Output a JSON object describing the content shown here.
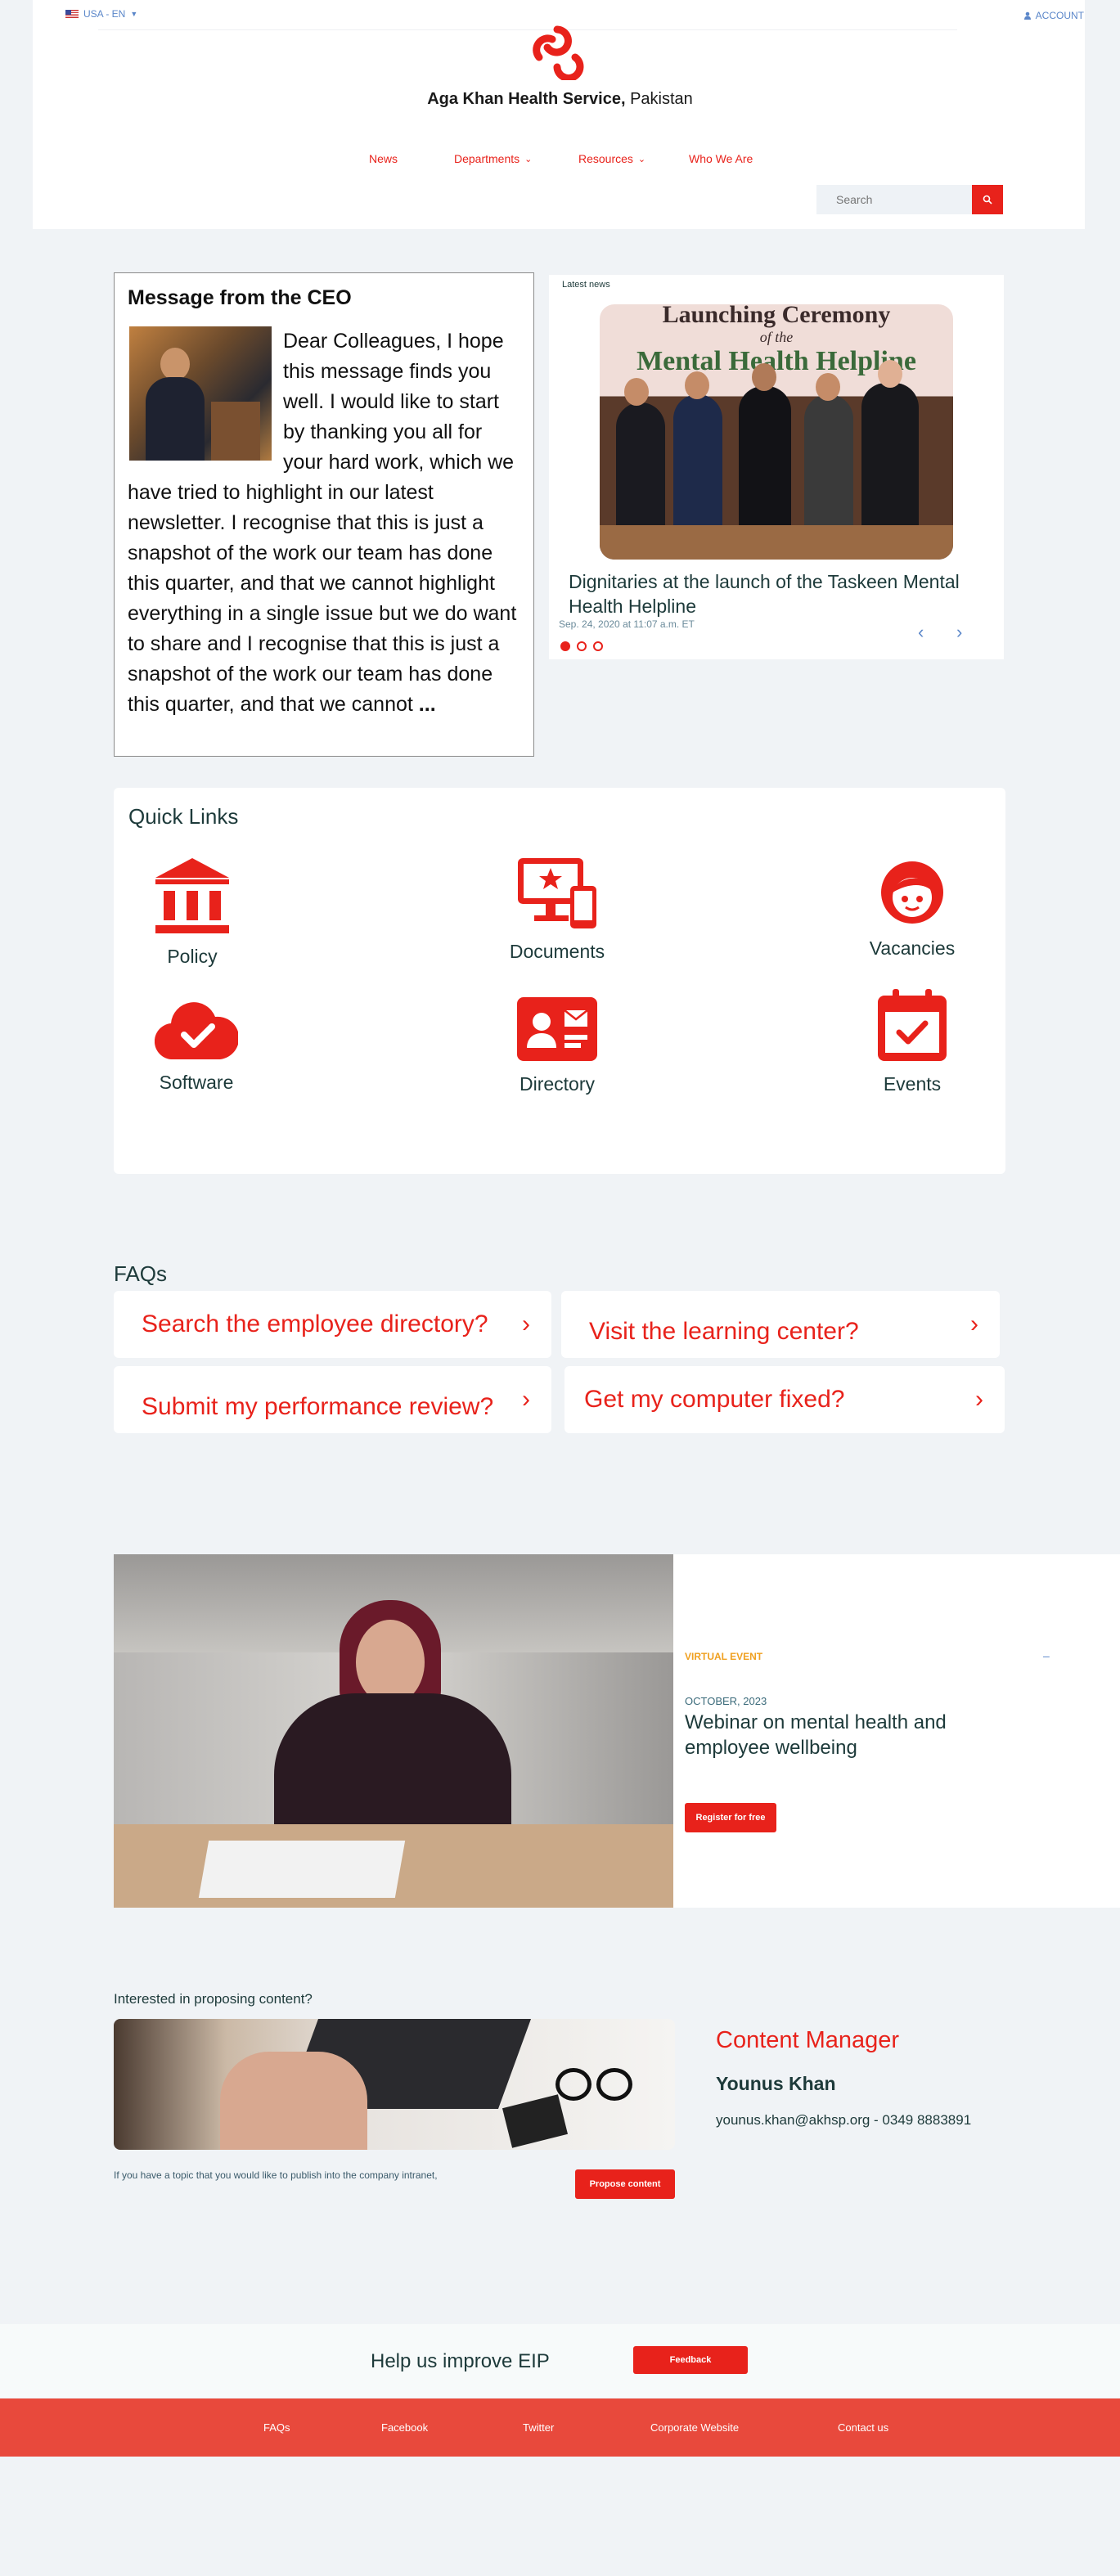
{
  "header": {
    "locale": "USA - EN",
    "account": "ACCOUNT",
    "brand_bold": "Aga Khan Health Service,",
    "brand_rest": " Pakistan",
    "nav": [
      "News",
      "Departments",
      "Resources",
      "Who We Are"
    ],
    "search_placeholder": "Search",
    "accent": "#e8221b"
  },
  "ceo": {
    "title": "Message from the CEO",
    "body": "Dear Colleagues, I hope this message finds you well.  I would like to start by thanking you all for your hard work, which we have tried to highlight in our latest newsletter.  I recognise that this is just a snapshot of the work our team has done this quarter, and that we cannot highlight everything in a single issue but we do want to share and I recognise that this is just a snapshot of the work our team has done this quarter, and that we cannot",
    "ellipsis": "..."
  },
  "news": {
    "label": "Latest news",
    "image_text_line1": "Launching Ceremony",
    "image_text_line2": "of the",
    "image_text_line3": "Mental Health Helpline",
    "caption": "Dignitaries at the launch of the Taskeen Mental Health Helpline",
    "date": "Sep. 24, 2020 at 11:07 a.m. ET"
  },
  "quick_links": {
    "title": "Quick Links",
    "items": [
      "Policy",
      "Documents",
      "Vacancies",
      "Software",
      "Directory",
      "Events"
    ]
  },
  "faqs": {
    "title": "FAQs",
    "items": [
      "Search the employee directory?",
      "Visit the learning center?",
      "Submit my performance review?",
      "Get my computer fixed?"
    ]
  },
  "event": {
    "tag": "VIRTUAL EVENT",
    "dash": "–",
    "date": "OCTOBER, 2023",
    "title": "Webinar on mental health and employee wellbeing",
    "button": "Register for free"
  },
  "proposal": {
    "title": "Interested in proposing content?",
    "text": "If you have a topic that you would like to publish into the company intranet,",
    "button": "Propose content",
    "manager_title": "Content Manager",
    "manager_name": "Younus Khan",
    "contact": "younus.khan@akhsp.org  -  0349 8883891"
  },
  "feedback": {
    "text": "Help us improve EIP",
    "button": "Feedback"
  },
  "footer": {
    "links": [
      "FAQs",
      "Facebook",
      "Twitter",
      "Corporate Website",
      "Contact us"
    ]
  }
}
